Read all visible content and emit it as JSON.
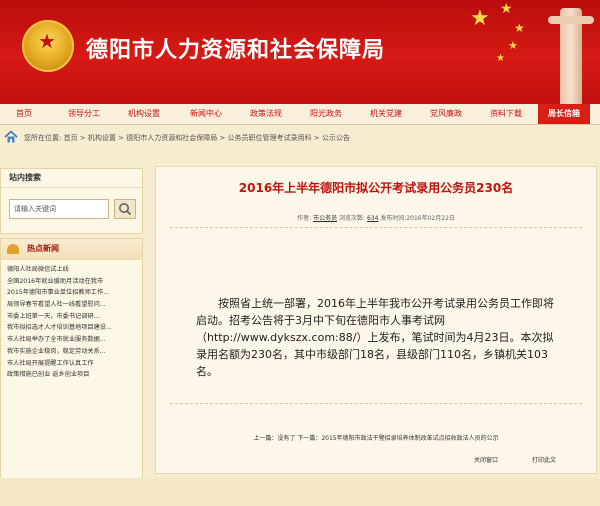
{
  "site": {
    "title": "德阳市人力资源和社会保障局"
  },
  "nav": {
    "items": [
      "首页",
      "领导分工",
      "机构设置",
      "新闻中心",
      "政策法规",
      "阳光政务",
      "机关党建",
      "党风廉政",
      "资料下载"
    ],
    "active": "局长信箱"
  },
  "breadcrumb": "您所在位置: 首页 > 机构设置 > 德阳市人力资源和社会保障局 > 公务员职位管理考试录用科 > 公示公告",
  "search": {
    "title": "站内搜索",
    "placeholder": "请输入关键词"
  },
  "hot_news": {
    "title": "热点新闻",
    "items": [
      "德阳人社局微信试上线",
      "全国2016年就业援助月活动在我市",
      "2015年德阳市事业单位招教师工作...",
      "局领导春节看望人社一线看望慰问...",
      "市委上班第一天，市委书记调研...",
      "我市拟招选才人才培训基地项目建设...",
      "市人社局举办了全市就业服务数据...",
      "我市实施企业稳岗，稳定劳动关系...",
      "市人社局开展提醒工作认真工作",
      "政策措施已创业 返乡创业项目"
    ]
  },
  "article": {
    "title": "2016年上半年德阳市拟公开考试录用公务员230名",
    "meta_prefix": "作者:",
    "meta_author": "市公务员",
    "meta_mid": "浏览次数:",
    "meta_count": "634",
    "meta_suffix": "发布时间:2016年02月22日",
    "body": "按照省上统一部署，2016年上半年我市公开考试录用公务员工作即将启动。招考公告将于3月中下旬在德阳市人事考试网（http://www.dykszx.com:88/）上发布，笔试时间为4月23日。本次拟录用名额为230名，其中市级部门18名，县级部门110名，乡镇机关103名。",
    "prev_next": "上一篇：没有了  下一篇：2015年德阳市政法干警招录培养体制改革试点招收政法人员的公示",
    "close_label": "关闭窗口",
    "print_label": "打印此文"
  },
  "colors": {
    "brand_red": "#d61a14",
    "gold": "#ffd84a",
    "background": "#f7ecd0",
    "title_red": "#c1130f"
  }
}
